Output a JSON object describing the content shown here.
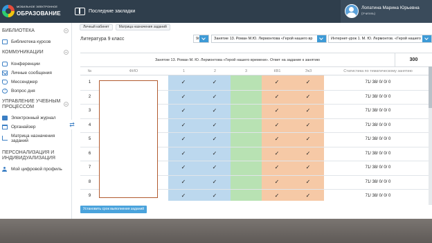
{
  "logo": {
    "line1": "МОБИЛЬНОЕ ЭЛЕКТРОННОЕ",
    "line2": "ОБРАЗОВАНИЕ"
  },
  "header": {
    "bookmarks_label": "Последние закладки"
  },
  "user": {
    "name": "Лопатина Марина Юрьевна",
    "role": "(Учитель)"
  },
  "sidebar": {
    "sections": [
      {
        "title": "БИБЛИОТЕКА",
        "items": [
          "Библиотека курсов"
        ]
      },
      {
        "title": "КОММУНИКАЦИИ",
        "items": [
          "Конференции",
          "Личные сообщения",
          "Мессенджер",
          "Вопрос дня"
        ]
      },
      {
        "title": "УПРАВЛЕНИЕ УЧЕБНЫМ ПРОЦЕССОМ",
        "items": [
          "Электронный журнал",
          "Органайзер",
          "Матрица назначения заданий"
        ]
      },
      {
        "title": "ПЕРСОНАЛИЗАЦИЯ И ИНДИВИДУАЛИЗАЦИЯ",
        "items": [
          "Мой цифровой профиль"
        ]
      }
    ]
  },
  "breadcrumbs": [
    "Личный кабинет",
    "Матрица назначения заданий"
  ],
  "filters": {
    "subject": "Литература 9 класс",
    "grade": "9г",
    "lesson": "Занятие 13. Роман М.Ю. Лермонтова «Герой нашего вр",
    "resource": "Интернет-урок 1. М. Ю. Лермонтов. «Герой нашего"
  },
  "matrix": {
    "lesson_title": "Занятие 13. Роман М. Ю. Лермонтова «Герой нашего времени». Ответ на задание к занятию",
    "score": "300",
    "headers": {
      "num": "№",
      "fio": "ФИО",
      "c1": "1",
      "c2": "2",
      "c3": "3",
      "c4": "КВ1",
      "c5": "ЭкЗ",
      "stats": "Статистика по тематическому занятию"
    },
    "rows": [
      {
        "n": "1",
        "stats": "71/ 38/ 0/ 0/ 0"
      },
      {
        "n": "2",
        "stats": "71/ 38/ 0/ 0/ 0"
      },
      {
        "n": "3",
        "stats": "71/ 38/ 0/ 0/ 0"
      },
      {
        "n": "4",
        "stats": "71/ 38/ 0/ 0/ 0"
      },
      {
        "n": "5",
        "stats": "71/ 38/ 0/ 0/ 0"
      },
      {
        "n": "6",
        "stats": "71/ 38/ 0/ 0/ 0"
      },
      {
        "n": "7",
        "stats": "71/ 38/ 0/ 0/ 0"
      },
      {
        "n": "8",
        "stats": "71/ 38/ 0/ 0/ 0"
      },
      {
        "n": "9",
        "stats": "71/ 38/ 0/ 0/ 0"
      }
    ],
    "check": "✓"
  },
  "actions": {
    "set_deadline": "Установить срок выполнения заданий"
  },
  "colors": {
    "topbar": "#2f3e4c",
    "blue_col": "#bcd8ee",
    "green_col": "#b8e2b3",
    "orange_col": "#f6c9a6",
    "accent": "#3d9ad6"
  }
}
